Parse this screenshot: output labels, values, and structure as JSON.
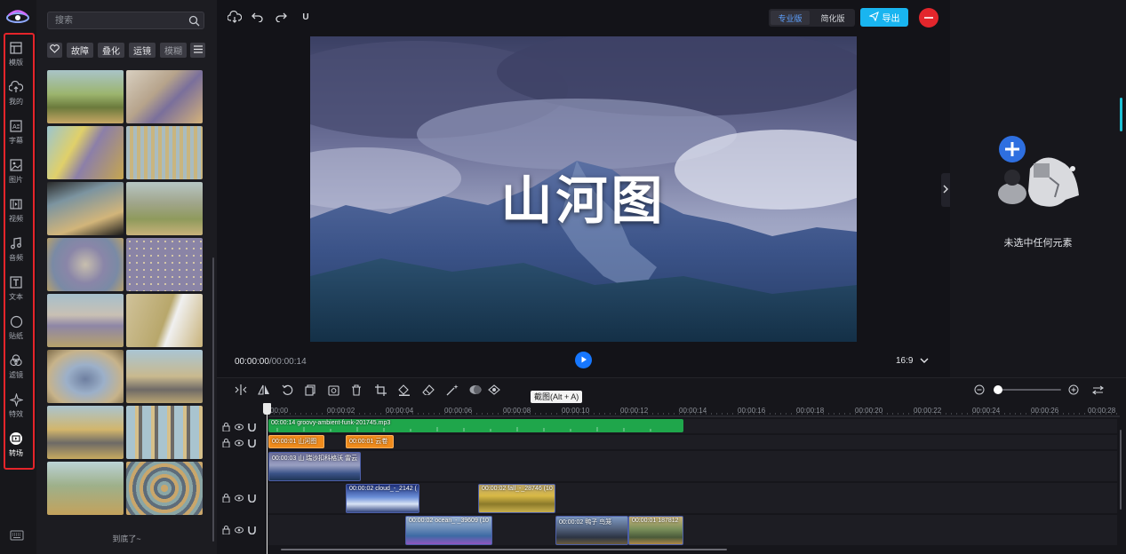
{
  "rail": {
    "items": [
      {
        "id": "template",
        "label": "模版",
        "icon": "layout-icon"
      },
      {
        "id": "mine",
        "label": "我的",
        "icon": "cloud-upload-icon"
      },
      {
        "id": "subtitle",
        "label": "字幕",
        "icon": "subtitle-icon"
      },
      {
        "id": "image",
        "label": "图片",
        "icon": "image-icon"
      },
      {
        "id": "video",
        "label": "视频",
        "icon": "film-icon"
      },
      {
        "id": "audio",
        "label": "音频",
        "icon": "music-icon"
      },
      {
        "id": "text",
        "label": "文本",
        "icon": "text-icon"
      },
      {
        "id": "sticker",
        "label": "贴纸",
        "icon": "sticker-icon"
      },
      {
        "id": "filter",
        "label": "滤镜",
        "icon": "filter-icon"
      },
      {
        "id": "effect",
        "label": "特效",
        "icon": "sparkle-icon"
      },
      {
        "id": "transition",
        "label": "转场",
        "icon": "transition-icon",
        "active": true
      }
    ]
  },
  "assets": {
    "search_placeholder": "搜索",
    "chips": [
      "故障",
      "叠化",
      "运镜",
      "模糊"
    ],
    "end_text": "到底了~"
  },
  "toolbar": {
    "undo_label": "U",
    "mode_pro": "专业版",
    "mode_simple": "简化版",
    "export_label": "导出"
  },
  "preview": {
    "video_title": "山河图",
    "current_time": "00:00:00",
    "total_time": "/00:00:14",
    "aspect_ratio": "16:9"
  },
  "props": {
    "empty_text": "未选中任何元素"
  },
  "timeline": {
    "tooltip": "截图(Alt + A)",
    "ruler_ticks": [
      "00:00",
      "00:00:02",
      "00:00:04",
      "00:00:06",
      "00:00:08",
      "00:00:10",
      "00:00:12",
      "00:00:14",
      "00:00:16",
      "00:00:18",
      "00:00:20",
      "00:00:22",
      "00:00:24",
      "00:00:26",
      "00:00:28"
    ],
    "audio_clip": "00:00:14  groovy-ambient-funk-201745.mp3",
    "text_clips": [
      "00:00:01  山河图",
      "00:00:01  云卷"
    ],
    "video_track1": [
      "00:00:03  山 瑞沙扣科格沃 雷云"
    ],
    "video_track2": [
      "00:00:02  cloud_-_2142 (",
      "00:00:02  fall_-_28746 (10"
    ],
    "video_track3": [
      "00:00:02  ocean_-_39609 (10",
      "00:00:02  鸭子 鸟笼",
      "00:00:01  187812"
    ]
  },
  "colors": {
    "accent_blue": "#1677ff",
    "export_blue": "#19b5f0",
    "highlight_red": "#e5242a",
    "audio_green": "#1fa64b",
    "text_orange": "#f08b1c"
  }
}
